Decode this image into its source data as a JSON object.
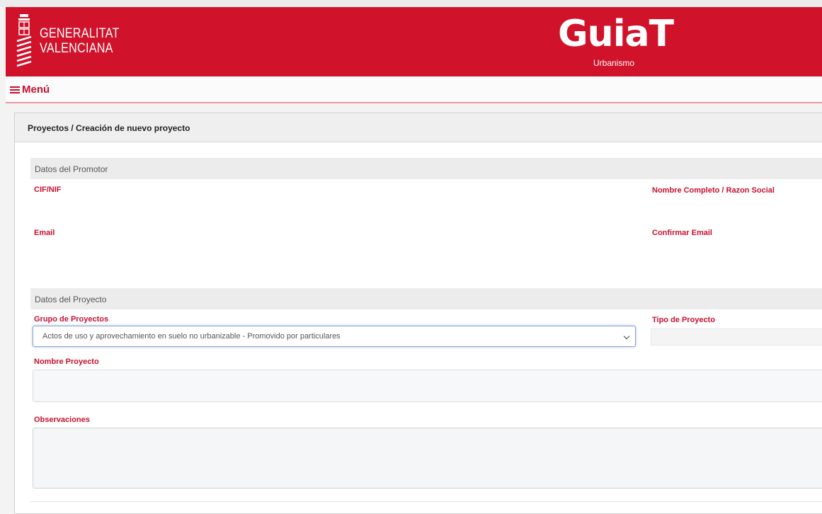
{
  "header": {
    "org_line1": "GENERALITAT",
    "org_line2": "VALENCIANA",
    "app_name": "GuiaT",
    "app_subtitle": "Urbanismo",
    "brand_color": "#d0132b"
  },
  "menu": {
    "label": "Menú",
    "icon": "hamburger-icon"
  },
  "breadcrumb": {
    "section": "Proyectos",
    "separator": " / ",
    "current": "Creación de nuevo proyecto"
  },
  "promotor": {
    "title": "Datos del Promotor",
    "cif_label": "CIF/NIF",
    "nombre_label": "Nombre Completo / Razon Social",
    "email_label": "Email",
    "confirm_email_label": "Confirmar Email"
  },
  "proyecto": {
    "title": "Datos del Proyecto",
    "grupo_label": "Grupo de Proyectos",
    "grupo_value": "Actos de uso y aprovechamiento en suelo no urbanizable - Promovido por particulares",
    "tipo_label": "Tipo de Proyecto",
    "nombre_label": "Nombre Proyecto",
    "observaciones_label": "Observaciones"
  }
}
